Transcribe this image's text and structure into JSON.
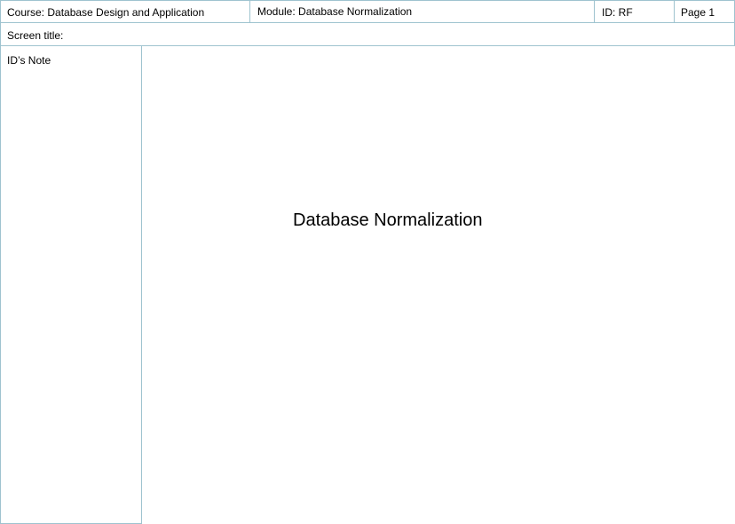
{
  "header": {
    "course": "Course:  Database Design and Application",
    "module": "Module: Database Normalization",
    "id": "ID: RF",
    "page": "Page 1"
  },
  "screen_title_label": "Screen title:",
  "notes_label": "ID’s Note",
  "content": {
    "title": "Database Normalization"
  },
  "colors": {
    "border": "#9ec3cf",
    "background": "#ffffff",
    "text": "#000000"
  }
}
